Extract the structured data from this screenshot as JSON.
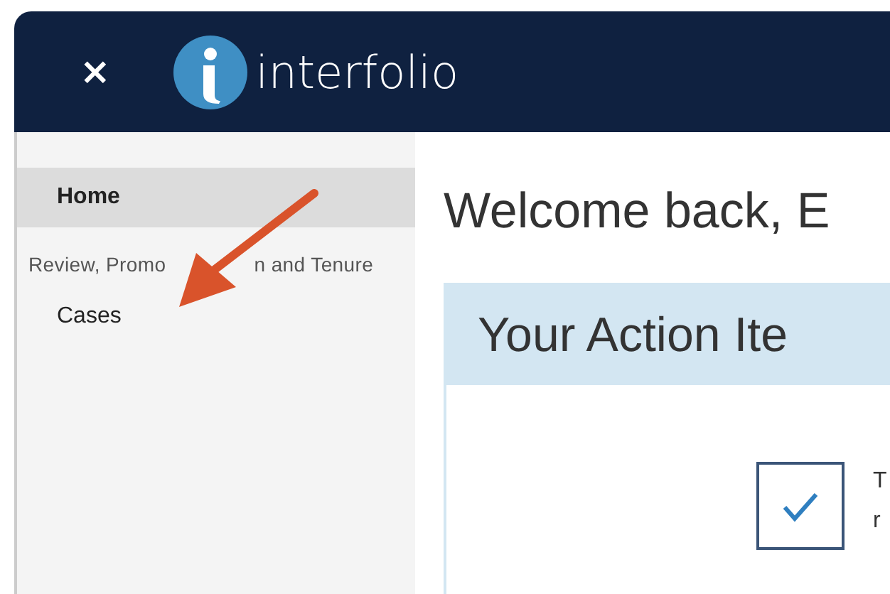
{
  "header": {
    "close": "×",
    "brand": "interfolio"
  },
  "sidebar": {
    "items": [
      {
        "label": "Home",
        "kind": "item",
        "selected": true
      },
      {
        "kind": "section",
        "parts": [
          "Review, Promo",
          "n and Tenure"
        ]
      },
      {
        "label": "Cases",
        "kind": "item",
        "selected": false
      }
    ]
  },
  "main": {
    "greeting": "Welcome back, E",
    "panel": {
      "title": "Your Action Ite",
      "task": {
        "checked": true,
        "lines": [
          "T",
          "r"
        ]
      }
    }
  }
}
